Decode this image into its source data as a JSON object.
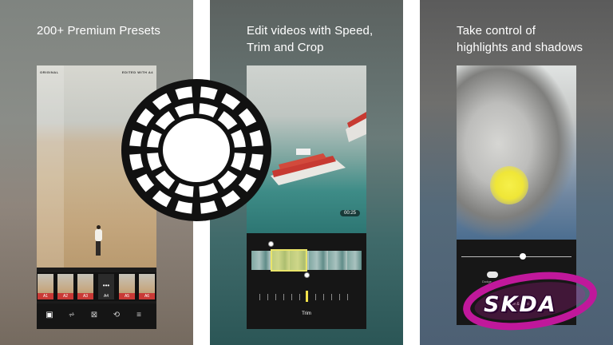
{
  "panels": [
    {
      "headline": "200+ Premium Presets"
    },
    {
      "headline_line1": "Edit videos with Speed,",
      "headline_line2": "Trim and Crop"
    },
    {
      "headline_line1": "Take control of",
      "headline_line2": "highlights and shadows"
    }
  ],
  "presets_screen": {
    "label_left": "ORIGINAL",
    "label_right": "EDITED WITH A4",
    "presets": [
      "A1",
      "A2",
      "A3",
      "A4",
      "A5",
      "A6"
    ],
    "selected_preset": "A4",
    "tools": [
      "preset-icon",
      "sliders-icon",
      "frame-icon",
      "history-icon",
      "menu-icon"
    ]
  },
  "video_screen": {
    "timecode": "00:25",
    "tool_label": "Trim"
  },
  "tone_screen": {
    "toggle_label": "Dodge",
    "mode_label": "Dodge & Burn"
  },
  "watermark": {
    "text": "SKDA"
  },
  "colors": {
    "preset_label_red": "#c93a36",
    "trim_yellow": "#e9e46a",
    "dodge_yellow": "#efe637",
    "watermark_magenta": "#c0189b"
  }
}
